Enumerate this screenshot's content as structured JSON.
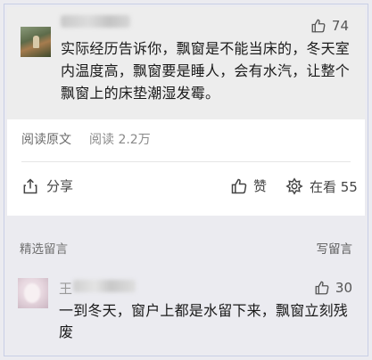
{
  "top_comment": {
    "like_count": "74",
    "text": "实际经历告诉你，飘窗是不能当床的，冬天室内温度高，飘窗要是睡人，会有水汽，让整个飘窗上的床垫潮湿发霉。"
  },
  "article_footer": {
    "read_original": "阅读原文",
    "read_count": "阅读 2.2万",
    "share_label": "分享",
    "like_label": "赞",
    "wow_label": "在看 55"
  },
  "comments_section": {
    "title": "精选留言",
    "write_label": "写留言",
    "comment": {
      "name_initial": "王",
      "like_count": "30",
      "text": "一到冬天，窗户上都是水留下来，飘窗立刻残废"
    }
  }
}
